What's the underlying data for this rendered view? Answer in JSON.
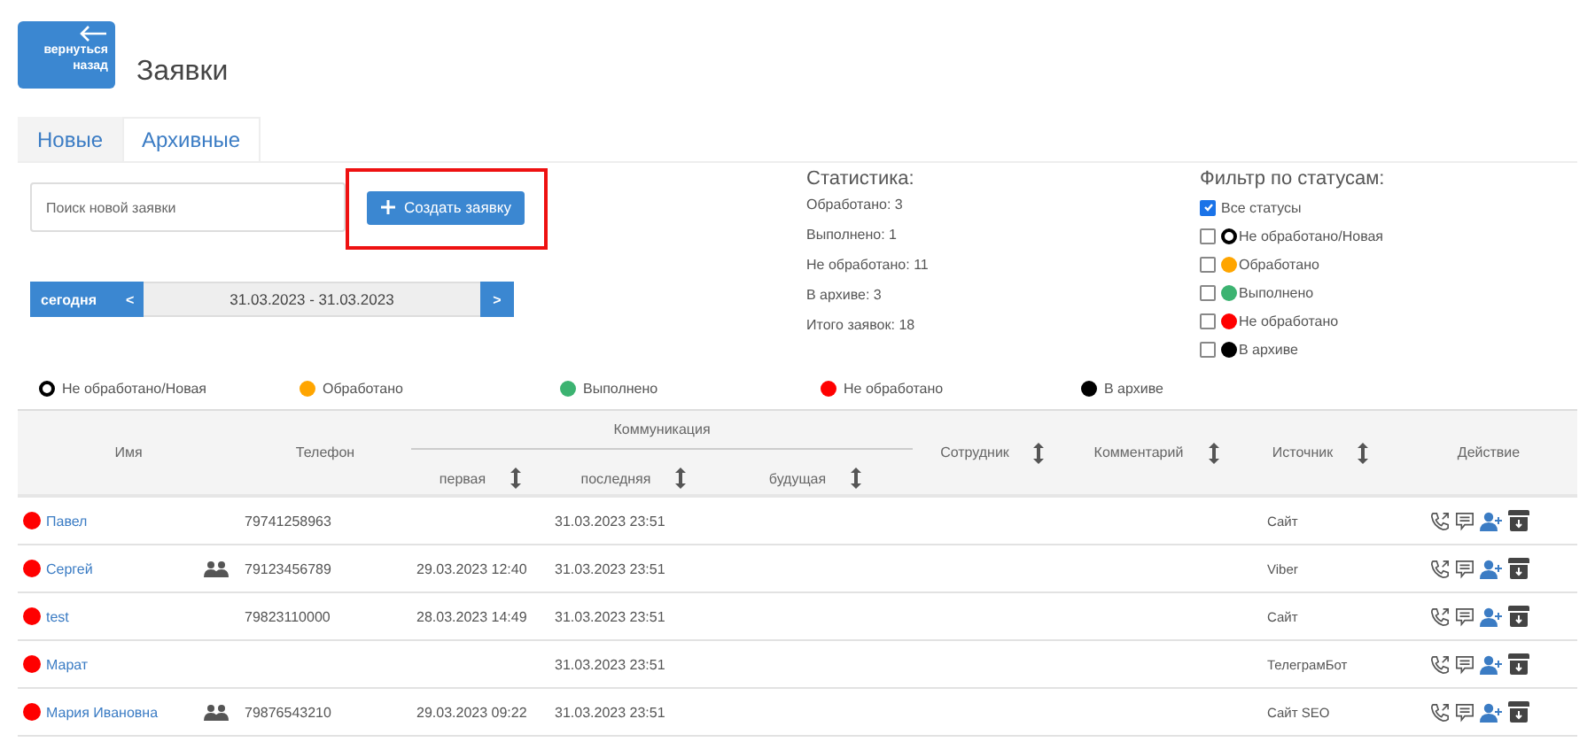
{
  "back_button": {
    "label": "вернуться назад"
  },
  "title": "Заявки",
  "tabs": [
    {
      "label": "Новые",
      "selected": false
    },
    {
      "label": "Архивные",
      "selected": true
    }
  ],
  "search": {
    "placeholder": "Поиск новой заявки"
  },
  "create_button": {
    "label": "Создать заявку",
    "highlighted": true
  },
  "date_nav": {
    "today": "сегодня",
    "prev": "<",
    "range": "31.03.2023 - 31.03.2023",
    "next": ">"
  },
  "stats": {
    "title": "Статистика:",
    "lines": [
      "Обработано: 3",
      "Выполнено: 1",
      "Не обработано: 11",
      "В архиве: 3",
      "Итого заявок: 18"
    ]
  },
  "filter": {
    "title": "Фильтр по статусам:",
    "items": [
      {
        "label": "Все статусы",
        "checked": true,
        "kind": "all"
      },
      {
        "label": "Не обработано/Новая",
        "checked": false,
        "kind": "hollow",
        "color": "#000000"
      },
      {
        "label": "Обработано",
        "checked": false,
        "kind": "dot",
        "color": "#ffa500"
      },
      {
        "label": "Выполнено",
        "checked": false,
        "kind": "dot",
        "color": "#3cb371"
      },
      {
        "label": "Не обработано",
        "checked": false,
        "kind": "dot",
        "color": "#ff0000"
      },
      {
        "label": "В архиве",
        "checked": false,
        "kind": "dot",
        "color": "#000000"
      }
    ]
  },
  "legend": [
    {
      "label": "Не обработано/Новая",
      "kind": "hollow",
      "color": "#000000"
    },
    {
      "label": "Обработано",
      "kind": "dot",
      "color": "#ffa500"
    },
    {
      "label": "Выполнено",
      "kind": "dot",
      "color": "#3cb371"
    },
    {
      "label": "Не обработано",
      "kind": "dot",
      "color": "#ff0000"
    },
    {
      "label": "В архиве",
      "kind": "dot",
      "color": "#000000"
    }
  ],
  "table": {
    "columns": [
      {
        "label": "Имя",
        "sortable": false
      },
      {
        "label": "Телефон",
        "sortable": false
      },
      {
        "label": "Коммуникация",
        "children": [
          {
            "label": "первая",
            "sortable": true
          },
          {
            "label": "последняя",
            "sortable": true
          },
          {
            "label": "будущая",
            "sortable": true
          }
        ]
      },
      {
        "label": "Сотрудник",
        "sortable": true
      },
      {
        "label": "Комментарий",
        "sortable": true
      },
      {
        "label": "Источник",
        "sortable": true
      },
      {
        "label": "Действие",
        "sortable": false
      }
    ],
    "rows": [
      {
        "color": "#ff0000",
        "name": "Павел",
        "group": false,
        "phone": "79741258963",
        "first": "",
        "last": "31.03.2023 23:51",
        "source": "Сайт"
      },
      {
        "color": "#ff0000",
        "name": "Сергей",
        "group": true,
        "phone": "79123456789",
        "first": "29.03.2023 12:40",
        "last": "31.03.2023 23:51",
        "source": "Viber"
      },
      {
        "color": "#ff0000",
        "name": "test",
        "group": false,
        "phone": "79823110000",
        "first": "28.03.2023 14:49",
        "last": "31.03.2023 23:51",
        "source": "Сайт"
      },
      {
        "color": "#ff0000",
        "name": "Марат",
        "group": false,
        "phone": "",
        "first": "",
        "last": "31.03.2023 23:51",
        "source": "ТелеграмБот"
      },
      {
        "color": "#ff0000",
        "name": "Мария Ивановна",
        "group": true,
        "phone": "79876543210",
        "first": "29.03.2023 09:22",
        "last": "31.03.2023 23:51",
        "source": "Сайт SEO"
      }
    ]
  }
}
